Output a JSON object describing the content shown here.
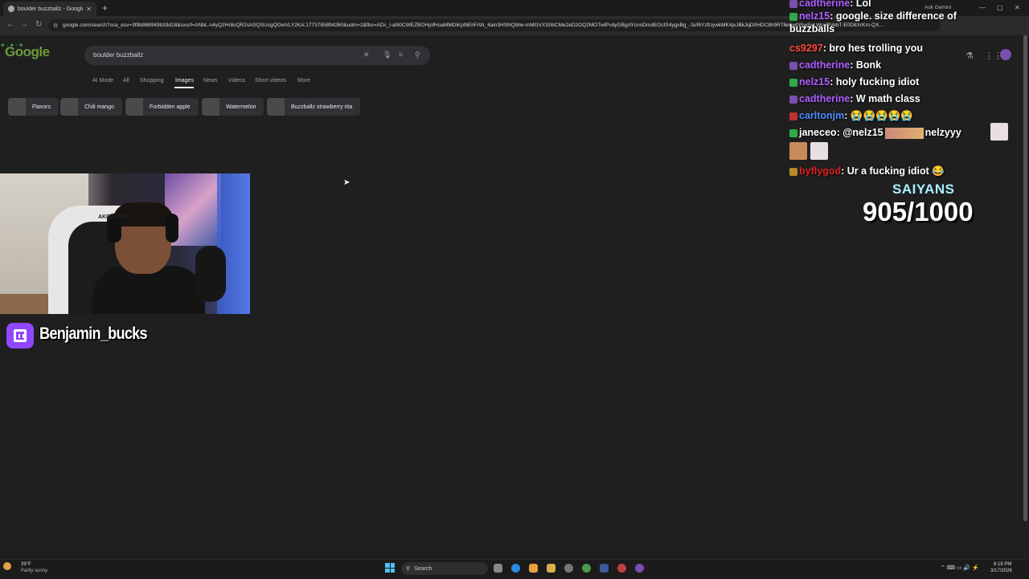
{
  "browser": {
    "tab_title": "boulder buzzballz - Google Se...",
    "tab_close": "✕",
    "new_tab": "+",
    "url": "google.com/search?sca_esv=3f9b988949b33d18&sxsrf=ANbL-n4yQ2Hr8cQR2sASQSUcgQOwVLY2KA:1773785894260&udm=2&fbs=ADc_l-aN0CWEZBOHjofHoaMMDiKp9lEhFAN_4ain3HSNQWw-mMGVXS0bCMe2eD2OQ2MOTwlPvdyGBgAYcnoDmdEOcIS4ygxBg_-3uf6YzfUywkMK4jxJBkJqD0HDC8h9R78e6w0iSwSoLWovPVebT-E0D8XrKm-QX...",
    "ask_gemini": "Ask Gemini",
    "back": "←",
    "forward": "→",
    "reload": "↻"
  },
  "google": {
    "logo": "Google",
    "query": "boulder buzzballz",
    "tabs": [
      "AI Mode",
      "All",
      "Shopping",
      "Images",
      "News",
      "Videos",
      "Short videos",
      "More"
    ],
    "active_tab": "Images",
    "chips": [
      "Flavors",
      "Chili mango",
      "Forbidden apple",
      "Watermelon",
      "Buzzballz strawberry rita"
    ]
  },
  "stream": {
    "streamer": "Benjamin_bucks",
    "chair_brand": "AKRACING"
  },
  "chat": [
    {
      "user": "cadtherine",
      "color": "#b05cff",
      "text": "Lol"
    },
    {
      "user": "nelz15",
      "color": "#b05cff",
      "text": "google. size difference of buzzballs"
    },
    {
      "user": "cs9297",
      "color": "#ff4a3a",
      "text": "bro hes trolling you"
    },
    {
      "user": "cadtherine",
      "color": "#b05cff",
      "text": "Bonk"
    },
    {
      "user": "nelz15",
      "color": "#b05cff",
      "text": "holy fucking idiot"
    },
    {
      "user": "cadtherine",
      "color": "#b05cff",
      "text": "W math class"
    },
    {
      "user": "carltonjm",
      "color": "#4a8cff",
      "text": "😭😭😭😭😭"
    },
    {
      "user": "janeceo",
      "color": "#ffffff",
      "text": "@nelz15",
      "extra": "nelzyyy"
    },
    {
      "user": "byflygod",
      "color": "#e02020",
      "text": "Ur a fucking idiot 😂"
    }
  ],
  "counter": {
    "title": "SAIYANS",
    "value": "905/1000"
  },
  "taskbar": {
    "temp": "39°F",
    "weather": "Partly sunny",
    "search": "Search",
    "time": "6:18 PM",
    "date": "3/17/2026"
  },
  "colors": {
    "accent_purple": "#9146ff",
    "counter_cyan": "#a8f0ff",
    "page_bg": "#1f1f1f"
  }
}
